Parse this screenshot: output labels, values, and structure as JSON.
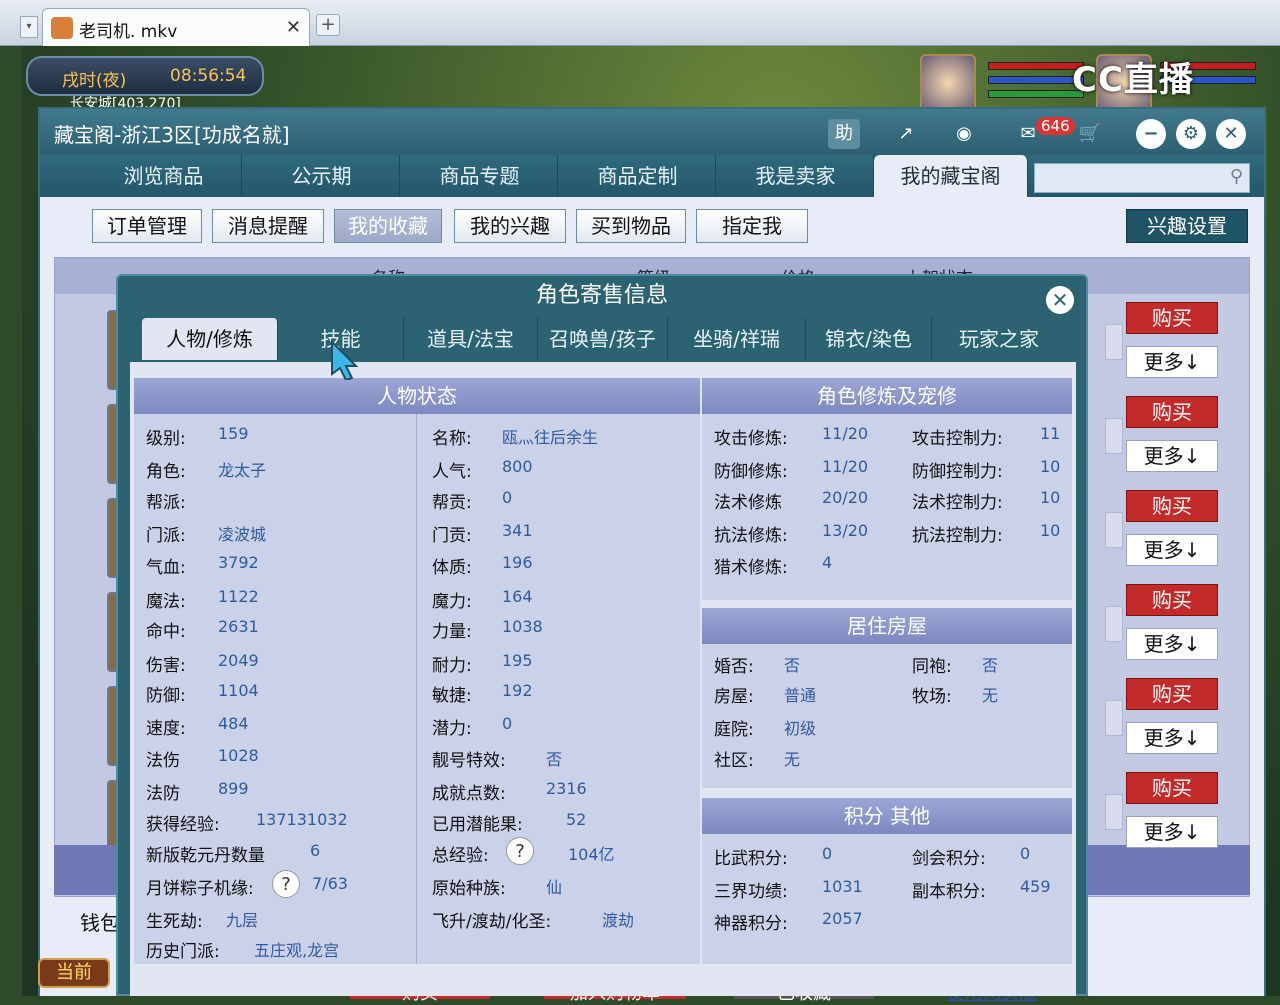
{
  "browser": {
    "tab_title": "老司机. mkv",
    "close": "✕",
    "newtab": "+"
  },
  "hud": {
    "time_label": "戌时(夜)",
    "time": "08:56:54",
    "location": "长安城[403,270]",
    "stream_logo": "CC直播",
    "current": "当前"
  },
  "window": {
    "title": "藏宝阁-浙江3区[功成名就]",
    "badge": "646",
    "help": "助"
  },
  "main_tabs": [
    "浏览商品",
    "公示期",
    "商品专题",
    "商品定制",
    "我是卖家",
    "我的藏宝阁"
  ],
  "sub_tabs": [
    "订单管理",
    "消息提醒",
    "我的收藏",
    "我的兴趣",
    "买到物品",
    "指定我"
  ],
  "interest_settings": "兴趣设置",
  "list": {
    "header": [
      "名称",
      "等级",
      "价格",
      "上架状态"
    ],
    "buy": "购买",
    "more": "更多↓",
    "wallet": "钱包"
  },
  "bottom_buttons": [
    "购买",
    "加入购物车",
    "已收藏",
    "使用网页版"
  ],
  "dialog": {
    "title": "角色寄售信息",
    "tabs": [
      "人物/修炼",
      "技能",
      "道具/法宝",
      "召唤兽/孩子",
      "坐骑/祥瑞",
      "锦衣/染色",
      "玩家之家"
    ],
    "status": {
      "header": "人物状态",
      "left": [
        {
          "label": "级别:",
          "value": "159"
        },
        {
          "label": "角色:",
          "value": "龙太子"
        },
        {
          "label": "帮派:",
          "value": ""
        },
        {
          "label": "门派:",
          "value": "凌波城"
        },
        {
          "label": "气血:",
          "value": "3792"
        },
        {
          "label": "魔法:",
          "value": "1122"
        },
        {
          "label": "命中:",
          "value": "2631"
        },
        {
          "label": "伤害:",
          "value": "2049"
        },
        {
          "label": "防御:",
          "value": "1104"
        },
        {
          "label": "速度:",
          "value": "484"
        },
        {
          "label": "法伤",
          "value": "1028"
        },
        {
          "label": "法防",
          "value": "899"
        },
        {
          "label": "获得经验:",
          "value": "137131032"
        },
        {
          "label": "新版乾元丹数量",
          "value": "6"
        },
        {
          "label": "月饼粽子机缘:",
          "value": "7/63"
        },
        {
          "label": "生死劫:",
          "value": "九层"
        },
        {
          "label": "历史门派:",
          "value": "五庄观,龙宫"
        }
      ],
      "right": [
        {
          "label": "名称:",
          "value": "瓯灬往后余生"
        },
        {
          "label": "人气:",
          "value": "800"
        },
        {
          "label": "帮贡:",
          "value": "0"
        },
        {
          "label": "门贡:",
          "value": "341"
        },
        {
          "label": "体质:",
          "value": "196"
        },
        {
          "label": "魔力:",
          "value": "164"
        },
        {
          "label": "力量:",
          "value": "1038"
        },
        {
          "label": "耐力:",
          "value": "195"
        },
        {
          "label": "敏捷:",
          "value": "192"
        },
        {
          "label": "潜力:",
          "value": "0"
        },
        {
          "label": "靓号特效:",
          "value": "否"
        },
        {
          "label": "成就点数:",
          "value": "2316"
        },
        {
          "label": "已用潜能果:",
          "value": "52"
        },
        {
          "label": "总经验:",
          "value": "104亿"
        },
        {
          "label": "原始种族:",
          "value": "仙"
        },
        {
          "label": "飞升/渡劫/化圣:",
          "value": "渡劫"
        }
      ]
    },
    "cultivation": {
      "header": "角色修炼及宠修",
      "rows": [
        {
          "l1": "攻击修炼:",
          "v1": "11/20",
          "l2": "攻击控制力:",
          "v2": "11"
        },
        {
          "l1": "防御修炼:",
          "v1": "11/20",
          "l2": "防御控制力:",
          "v2": "10"
        },
        {
          "l1": "法术修炼",
          "v1": "20/20",
          "l2": "法术控制力:",
          "v2": "10"
        },
        {
          "l1": "抗法修炼:",
          "v1": "13/20",
          "l2": "抗法控制力:",
          "v2": "10"
        },
        {
          "l1": "猎术修炼:",
          "v1": "4",
          "l2": "",
          "v2": ""
        }
      ]
    },
    "house": {
      "header": "居住房屋",
      "rows": [
        {
          "l1": "婚否:",
          "v1": "否",
          "l2": "同袍:",
          "v2": "否"
        },
        {
          "l1": "房屋:",
          "v1": "普通",
          "l2": "牧场:",
          "v2": "无"
        },
        {
          "l1": "庭院:",
          "v1": "初级",
          "l2": "",
          "v2": ""
        },
        {
          "l1": "社区:",
          "v1": "无",
          "l2": "",
          "v2": ""
        }
      ]
    },
    "points": {
      "header": "积分 其他",
      "rows": [
        {
          "l1": "比武积分:",
          "v1": "0",
          "l2": "剑会积分:",
          "v2": "0"
        },
        {
          "l1": "三界功绩:",
          "v1": "1031",
          "l2": "副本积分:",
          "v2": "459"
        },
        {
          "l1": "神器积分:",
          "v1": "2057",
          "l2": "",
          "v2": ""
        }
      ]
    },
    "help_mark": "?"
  },
  "colors": {
    "accent": "#2c6373",
    "value": "#2e5b9e",
    "buy": "#c32a2a"
  }
}
